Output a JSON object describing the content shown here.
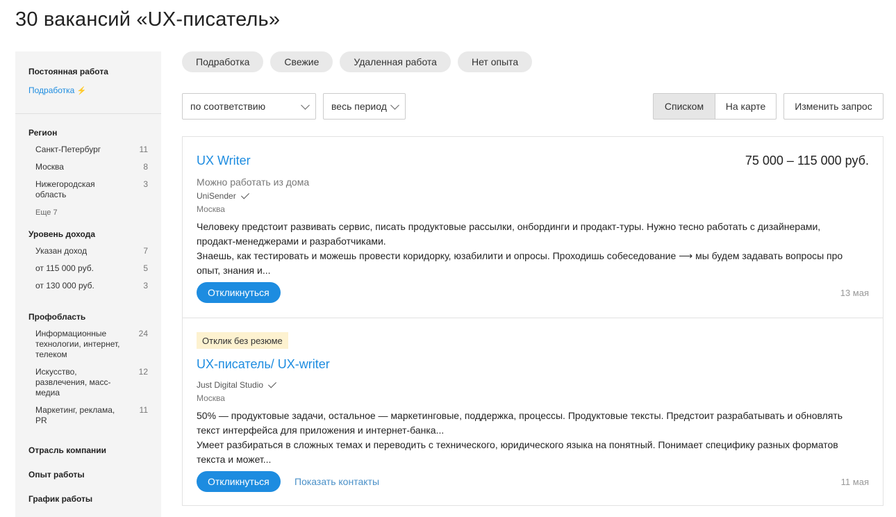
{
  "page": {
    "title": "30 вакансий «UX-писатель»"
  },
  "sidebar": {
    "employment_heading": "Постоянная работа",
    "employment_link": "Подработка",
    "region": {
      "heading": "Регион",
      "items": [
        {
          "label": "Санкт-Петербург",
          "count": "11"
        },
        {
          "label": "Москва",
          "count": "8"
        },
        {
          "label": "Нижегородская область",
          "count": "3"
        }
      ],
      "more": "Еще 7"
    },
    "income": {
      "heading": "Уровень дохода",
      "items": [
        {
          "label": "Указан доход",
          "count": "7"
        },
        {
          "label": "от 115 000 руб.",
          "count": "5"
        },
        {
          "label": "от 130 000 руб.",
          "count": "3"
        }
      ]
    },
    "profarea": {
      "heading": "Профобласть",
      "items": [
        {
          "label": "Информационные технологии, интернет, телеком",
          "count": "24"
        },
        {
          "label": "Искусство, развлечения, масс-медиа",
          "count": "12"
        },
        {
          "label": "Маркетинг, реклама, PR",
          "count": "11"
        }
      ]
    },
    "industry_heading": "Отрасль компании",
    "experience_heading": "Опыт работы",
    "schedule_heading": "График работы"
  },
  "chips": [
    "Подработка",
    "Свежие",
    "Удаленная работа",
    "Нет опыта"
  ],
  "filters": {
    "sort": "по соответствию",
    "period": "весь период",
    "view_list": "Списком",
    "view_map": "На карте",
    "change_query": "Изменить запрос"
  },
  "vacancies": [
    {
      "title": "UX Writer",
      "salary": "75 000 – 115 000 руб.",
      "remote": "Можно работать из дома",
      "company": "UniSender",
      "city": "Москва",
      "description_1": "Человеку предстоит развивать сервис, писать продуктовые рассылки, онбординги и продакт-туры. Нужно тесно работать с дизайнерами, продакт-менеджерами и разработчиками.",
      "description_2": "Знаешь, как тестировать и можешь провести коридорку, юзабилити и опросы. Проходишь собеседование ⟶ мы будем задавать вопросы про опыт, знания и...",
      "apply": "Откликнуться",
      "date": "13 мая"
    },
    {
      "badge": "Отклик без резюме",
      "title": "UX-писатель/ UX-writer",
      "company": "Just Digital Studio",
      "city": "Москва",
      "description_1": "50% — продуктовые задачи, остальное — маркетинговые, поддержка, процессы. Продуктовые тексты. Предстоит разрабатывать и обновлять текст интерфейса для приложения и интернет-банка...",
      "description_2": "Умеет разбираться в сложных темах и переводить с технического, юридического языка на понятный. Понимает специфику разных форматов текста и может...",
      "apply": "Откликнуться",
      "contacts": "Показать контакты",
      "date": "11 мая"
    }
  ]
}
